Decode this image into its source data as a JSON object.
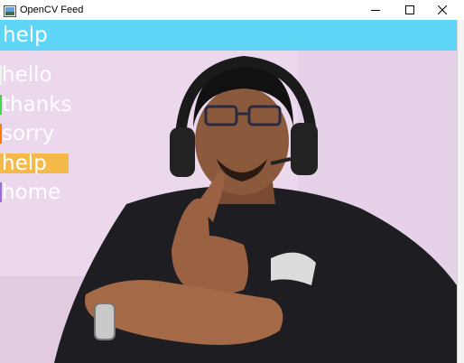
{
  "window": {
    "title": "OpenCV Feed",
    "minimize_icon": "minimize-icon",
    "maximize_icon": "maximize-icon",
    "close_icon": "close-icon"
  },
  "prediction": {
    "text": "help",
    "color": "#5fd5f7"
  },
  "actions": [
    {
      "label": "hello",
      "bar_color": "#e8f7e6",
      "probability": 0.01
    },
    {
      "label": "thanks",
      "bar_color": "#41d94a",
      "probability": 0.01
    },
    {
      "label": "sorry",
      "bar_color": "#ff7a00",
      "probability": 0.01
    },
    {
      "label": "help",
      "bar_color": "#f5b94a",
      "probability": 0.97
    },
    {
      "label": "home",
      "bar_color": "#9b6bdc",
      "probability": 0.0
    }
  ]
}
